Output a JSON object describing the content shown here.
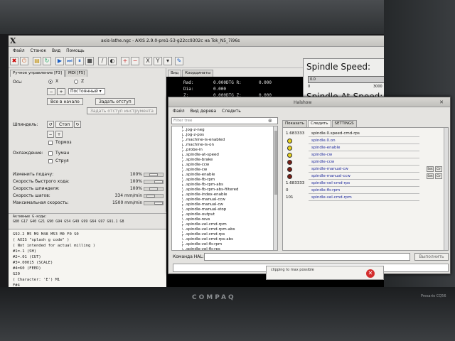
{
  "axis": {
    "title": "axis-lathe.ngc - AXIS 2.9.0-pre1-53-g22cc9302c на Tok_N5_7i96s",
    "menu": [
      "Файл",
      "Станок",
      "Вид",
      "Помощь"
    ],
    "tabs": {
      "manual": "Ручное управление [F3]",
      "mdi": "MDI [F5]"
    },
    "axes_label": "Ось:",
    "axis_x": "X",
    "axis_z": "Z",
    "jog_mode": "Постоянный",
    "home_button": "Все в начало",
    "touchoff_button": "Задать отступ",
    "tool_touchoff_button": "Задать отступ инструмента",
    "spindle_label": "Шпиндель:",
    "spindle_stop": "Стоп",
    "brake_label": "Тормоз",
    "coolant_label": "Охлаждение:",
    "mist_label": "Туман",
    "flood_label": "Струя",
    "overrides": [
      {
        "label": "Изменить подачу:",
        "value": "100%",
        "level": 0.5
      },
      {
        "label": "Скорость быстрого хода:",
        "value": "100%",
        "level": 1.0
      },
      {
        "label": "Скорость шпинделя:",
        "value": "100%",
        "level": 0.5
      },
      {
        "label": "Скорость шагов:",
        "value": "334 mm/min",
        "level": 0.2
      },
      {
        "label": "Максимальная скорость:",
        "value": "1500 mm/min",
        "level": 1.0
      }
    ],
    "active_gcodes_label": "Активные G-коды:",
    "active_gcodes": [
      "G80 G17 G40 G21 G90 G94 G54 G49 G99 G64 G97 G91.1 G8",
      "G92.2 M5 M9 M48 M53 M0 F0 S0"
    ],
    "code_lines": [
      "( AXIS \"splash g code\" )",
      "( Not intended for actual milling )",
      "#1=.1 (SH)",
      "#2=.01 (CUT)",
      "#3=.00015 (SCALE)",
      "#4=60 (FEED)",
      "G20",
      "( Character: 'E') M1",
      "F#4"
    ],
    "preview_tabs": [
      "Вид",
      "Координаты"
    ],
    "dro": [
      {
        "axis": "Rad:",
        "value": "0.000",
        "dtg_label": "DTG R:",
        "dtg": "0.000"
      },
      {
        "axis": "Dia:",
        "value": "0.000",
        "dtg_label": "",
        "dtg": ""
      },
      {
        "axis": "Z:",
        "value": "0.000",
        "dtg_label": "DTG Z:",
        "dtg": "0.000"
      }
    ]
  },
  "pyvcp": {
    "spindle_speed_label": "Spindle Speed:",
    "bar_value": "0.0",
    "bar_min": "0",
    "bar_max": "3000",
    "bar_level": 0.0,
    "at_speed_label": "Spindle-At-Speed:"
  },
  "halshow": {
    "title": "Halshow",
    "menu": [
      "Файл",
      "Вид дерева",
      "Следить"
    ],
    "filter_placeholder": "Filter tree",
    "tree_items": [
      "jog-z-neg",
      "jog-z-pos",
      "machine-is-enabled",
      "machine-is-on",
      "probe-in",
      "spindle-at-speed",
      "spindle-brake",
      "spindle-ccw",
      "spindle-cw",
      "spindle-enable",
      "spindle-fb-rpm",
      "spindle-fb-rpm-abs",
      "spindle-fb-rpm-abs-filtered",
      "spindle-index-enable",
      "spindle-manual-ccw",
      "spindle-manual-cw",
      "spindle-manual-stop",
      "spindle-output",
      "spindle-revs",
      "spindle-vel-cmd-rpm",
      "spindle-vel-cmd-rpm-abs",
      "spindle-vel-cmd-rps",
      "spindle-vel-cmd-rps-abs",
      "spindle-vel-fb-rpm",
      "spindle-vel-fb-rps"
    ],
    "tabs": [
      "Показать",
      "Следить",
      "SETTINGS"
    ],
    "watch": [
      {
        "value": "1.683333",
        "name": "spindle.0.speed-cmd-rps",
        "kind": "param"
      },
      {
        "led": "#e8d21e",
        "name": "spindle.0.on",
        "kind": "pin"
      },
      {
        "led": "#e8d21e",
        "name": "spindle-enable",
        "kind": "pin"
      },
      {
        "led": "#e8d21e",
        "name": "spindle-cw",
        "kind": "pin"
      },
      {
        "led": "#7a1d14",
        "name": "spindle-ccw",
        "kind": "pin"
      },
      {
        "led": "#7a1d14",
        "name": "spindle-manual-cw",
        "kind": "pin",
        "buttons": [
          "Set",
          "Clr"
        ]
      },
      {
        "led": "#7a1d14",
        "name": "spindle-manual-ccw",
        "kind": "pin",
        "buttons": [
          "Set",
          "Clr"
        ]
      },
      {
        "value": "1.683333",
        "name": "spindle-vel-cmd-rps",
        "kind": "pin"
      },
      {
        "value": "0",
        "name": "spindle-fb-rpm",
        "kind": "pin"
      },
      {
        "value": "101",
        "name": "spindle-vel-cmd-rpm",
        "kind": "pin"
      }
    ],
    "command_label": "Команда HAL:",
    "execute_button": "Выполнить"
  },
  "notification": {
    "text": "clipping to max possible"
  },
  "bezel": {
    "brand": "COMPAQ",
    "brand_right": "Presario CQ56"
  }
}
